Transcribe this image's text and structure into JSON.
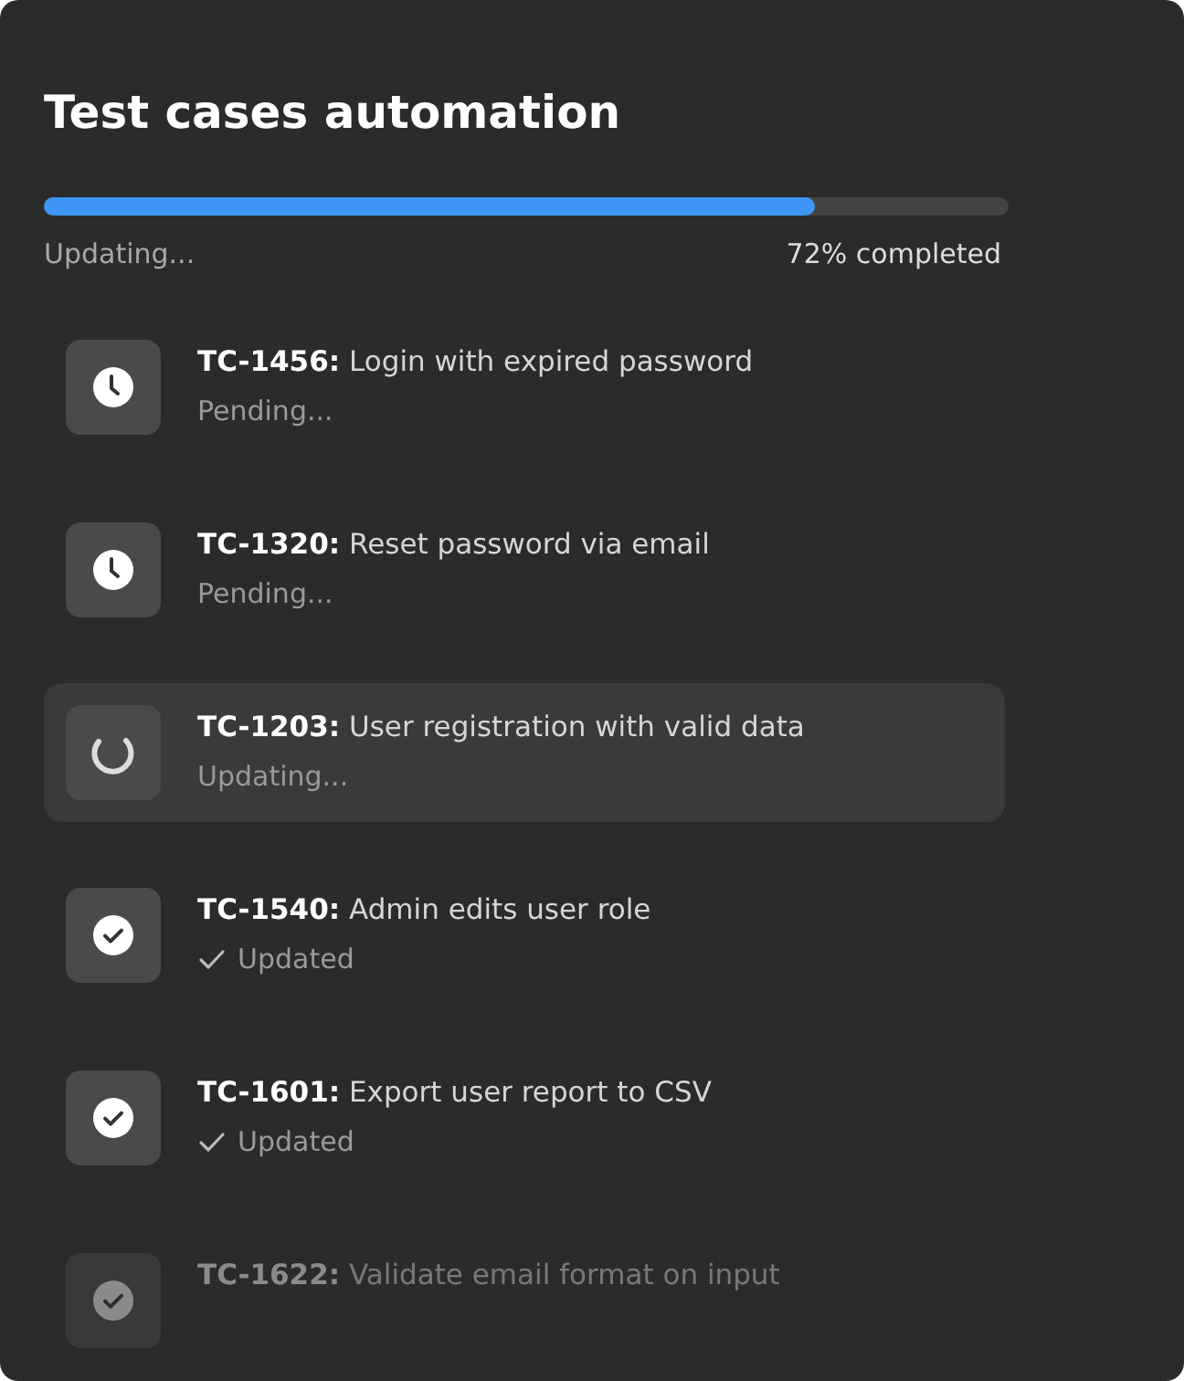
{
  "title": "Test cases automation",
  "progress": {
    "level": 0.8,
    "status": "Updating...",
    "reading": "72% completed"
  },
  "items": [
    {
      "title": "**TC-1456:** Login with expired password",
      "kind": "pending",
      "status": "Pending...",
      "selected": false,
      "faded": false
    },
    {
      "title": "**TC-1320:** Reset password via email",
      "kind": "pending",
      "status": "Pending...",
      "selected": false,
      "faded": false
    },
    {
      "title": "**TC-1203:** User registration with valid data",
      "kind": "updating",
      "status": "Updating...",
      "selected": true,
      "faded": false
    },
    {
      "title": "**TC-1540:** Admin edits user role",
      "kind": "updated",
      "status": "Updated",
      "selected": false,
      "faded": false
    },
    {
      "title": "**TC-1601:** Export user report to CSV",
      "kind": "updated",
      "status": "Updated",
      "selected": false,
      "faded": false
    },
    {
      "title": "**TC-1622:** Validate email format on input",
      "kind": "updated",
      "selected": false,
      "faded": true
    }
  ]
}
